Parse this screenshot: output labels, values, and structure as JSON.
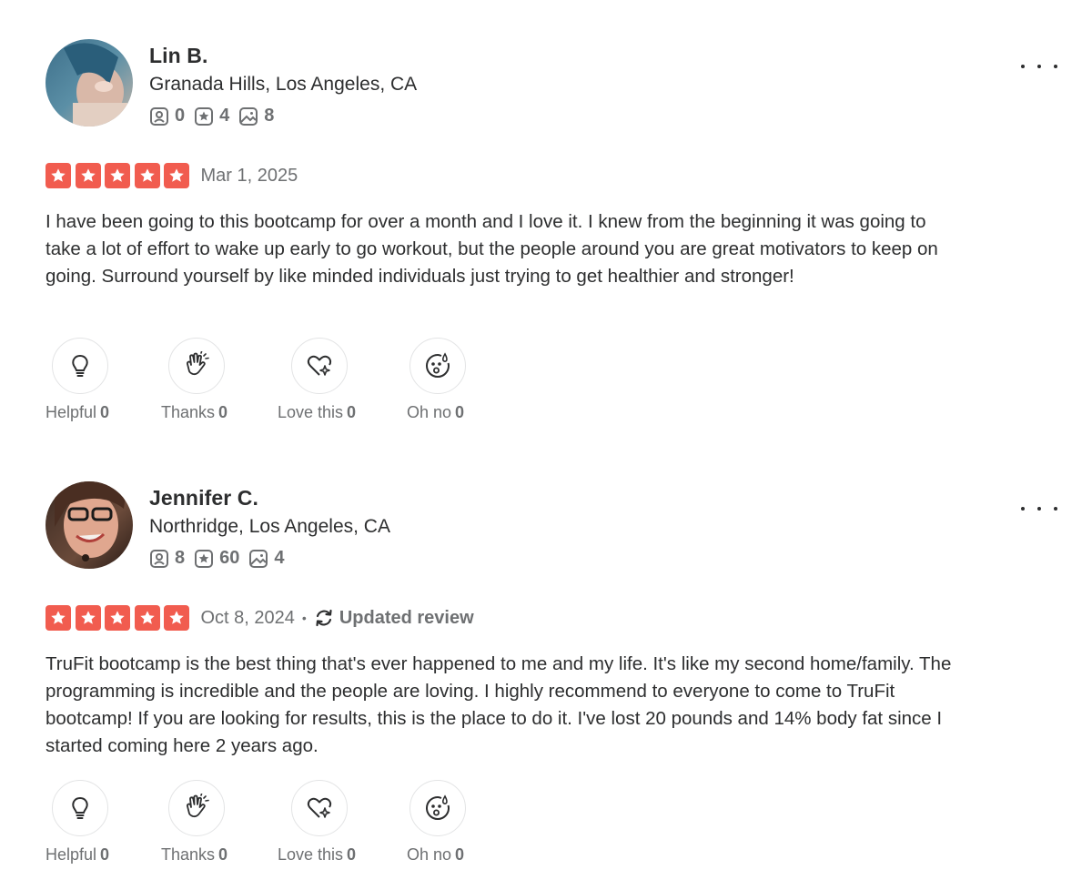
{
  "reviews": [
    {
      "user": {
        "name": "Lin B.",
        "location": "Granada Hills, Los Angeles, CA",
        "stats": {
          "friends": "0",
          "reviews": "4",
          "photos": "8"
        }
      },
      "rating": 5,
      "date": "Mar 1, 2025",
      "updated_label": "",
      "text": "I have been going to this bootcamp for over a month and I love it. I knew from the beginning it was going to take a lot of effort to wake up early to go workout, but the people around you are great motivators to keep on going. Surround yourself by like minded individuals just trying to get healthier and stronger!",
      "reactions": {
        "helpful": {
          "label": "Helpful",
          "count": "0"
        },
        "thanks": {
          "label": "Thanks",
          "count": "0"
        },
        "love": {
          "label": "Love this",
          "count": "0"
        },
        "ohno": {
          "label": "Oh no",
          "count": "0"
        }
      }
    },
    {
      "user": {
        "name": "Jennifer C.",
        "location": "Northridge, Los Angeles, CA",
        "stats": {
          "friends": "8",
          "reviews": "60",
          "photos": "4"
        }
      },
      "rating": 5,
      "date": "Oct 8, 2024",
      "separator": "•",
      "updated_label": "Updated review",
      "text": "TruFit bootcamp is the best thing that's ever happened to me and my life. It's like my second home/family. The programming is incredible and the people are loving. I highly recommend to everyone to come to TruFit bootcamp! If you are looking for results, this is the place to do it. I've lost 20 pounds and 14% body fat since I started coming here 2 years ago.",
      "reactions": {
        "helpful": {
          "label": "Helpful",
          "count": "0"
        },
        "thanks": {
          "label": "Thanks",
          "count": "0"
        },
        "love": {
          "label": "Love this",
          "count": "0"
        },
        "ohno": {
          "label": "Oh no",
          "count": "0"
        }
      }
    }
  ],
  "colors": {
    "star_red": "#f15c4f",
    "muted_text": "#6e7072",
    "body_text": "#2d2e2f"
  },
  "icons": [
    "friends-icon",
    "review-count-icon",
    "photo-count-icon",
    "more-options-icon",
    "star-icon",
    "updated-review-icon",
    "lightbulb-icon",
    "clapping-hands-icon",
    "heart-sparkle-icon",
    "shocked-face-icon"
  ]
}
